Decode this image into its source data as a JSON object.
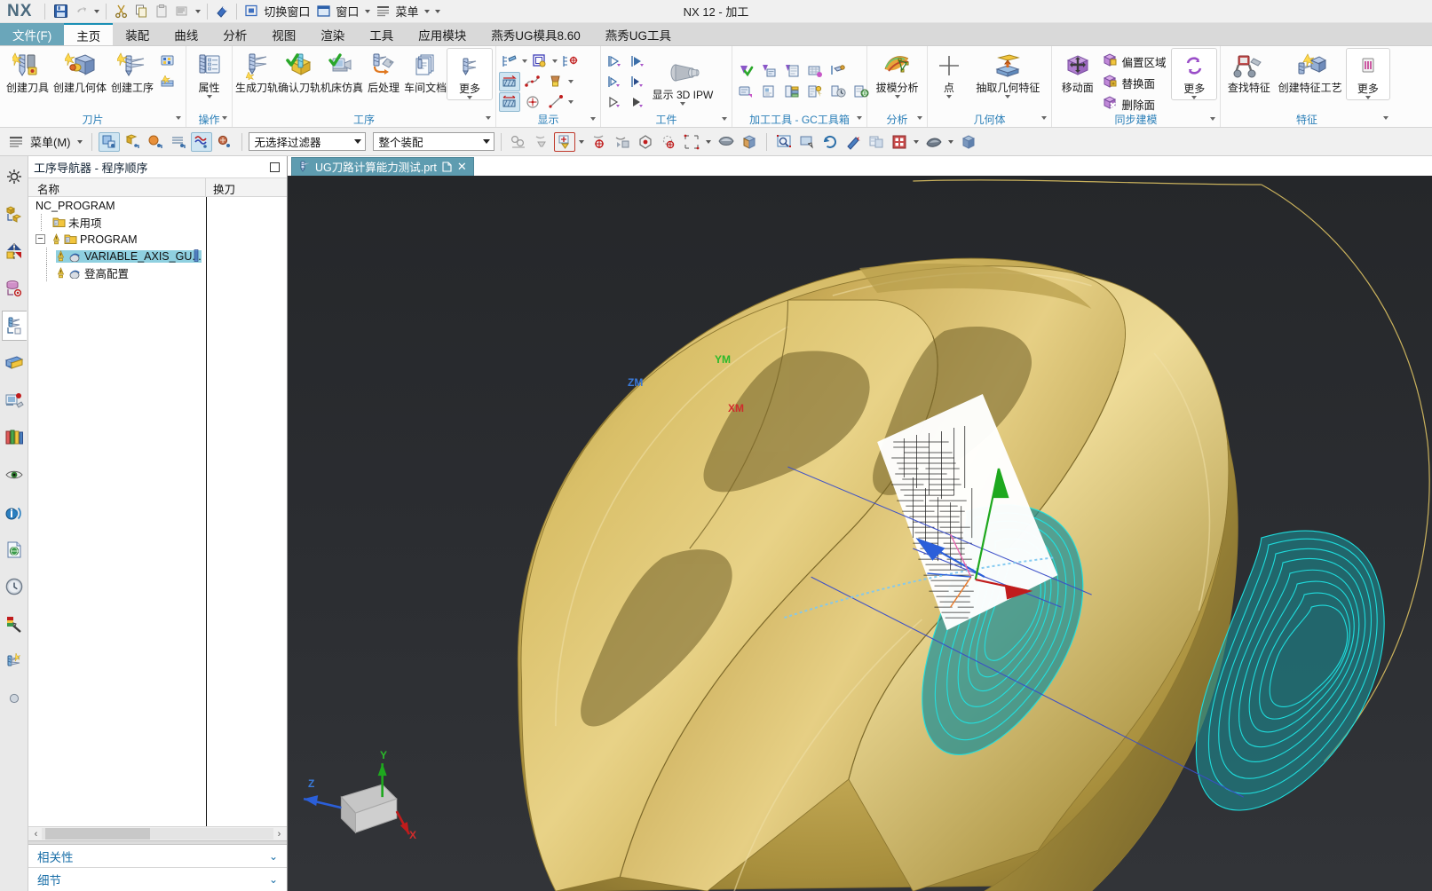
{
  "window": {
    "title": "NX 12 - 加工",
    "logo": "NX"
  },
  "quickaccess": {
    "items": [
      {
        "name": "save",
        "icon": "save-icon"
      },
      {
        "name": "undo",
        "icon": "undo-icon",
        "caret": true
      },
      {
        "name": "cut",
        "icon": "cut-icon"
      },
      {
        "name": "copy",
        "icon": "copy-icon"
      },
      {
        "name": "paste",
        "icon": "paste-icon"
      },
      {
        "name": "paste-special",
        "icon": "paste-special-icon",
        "caret": true
      },
      {
        "name": "eraser",
        "icon": "eraser-icon"
      }
    ],
    "switch_window": "切换窗口",
    "window": "窗口",
    "menu": "菜单"
  },
  "tabs": [
    {
      "label": "文件(F)",
      "kind": "file"
    },
    {
      "label": "主页",
      "kind": "active"
    },
    {
      "label": "装配",
      "kind": "normal"
    },
    {
      "label": "曲线",
      "kind": "normal"
    },
    {
      "label": "分析",
      "kind": "normal"
    },
    {
      "label": "视图",
      "kind": "normal"
    },
    {
      "label": "渲染",
      "kind": "normal"
    },
    {
      "label": "工具",
      "kind": "normal"
    },
    {
      "label": "应用模块",
      "kind": "normal"
    },
    {
      "label": "燕秀UG模具8.60",
      "kind": "normal"
    },
    {
      "label": "燕秀UG工具",
      "kind": "normal"
    }
  ],
  "ribbon": {
    "groups": [
      {
        "title": "刀片",
        "big": [
          {
            "label": "创建刀具",
            "icon": "create-tool-icon"
          },
          {
            "label": "创建几何体",
            "icon": "create-geometry-icon"
          },
          {
            "label": "创建工序",
            "icon": "create-operation-icon"
          }
        ],
        "small": [
          {
            "icon": "program-group-icon"
          },
          {
            "icon": "method-group-icon"
          }
        ]
      },
      {
        "title": "操作",
        "big": [
          {
            "label": "属性",
            "icon": "properties-icon",
            "dd": true
          }
        ],
        "small": []
      },
      {
        "title": "工序",
        "big": [
          {
            "label": "生成刀轨",
            "icon": "generate-toolpath-icon"
          },
          {
            "label": "确认刀轨",
            "icon": "verify-toolpath-icon"
          },
          {
            "label": "机床仿真",
            "icon": "machine-simulation-icon"
          },
          {
            "label": "后处理",
            "icon": "postprocess-icon"
          },
          {
            "label": "车间文档",
            "icon": "shop-documentation-icon"
          },
          {
            "label": "更多",
            "icon": "more-operation-icon",
            "framed": true,
            "dd": true
          }
        ],
        "small": []
      },
      {
        "title": "显示",
        "big": [],
        "small": [
          {
            "icon": "display-toolpath-icon",
            "caret": true
          },
          {
            "icon": "display-ipw-icon",
            "caret": true
          },
          {
            "icon": "display-target-icon"
          },
          {
            "icon": "cut-region-icon",
            "selected": true
          },
          {
            "icon": "spline-icon"
          },
          {
            "icon": "tool-display-icon",
            "caret": true
          },
          {
            "icon": "trim-region-icon",
            "selected": true
          },
          {
            "icon": "circle-center-icon"
          },
          {
            "icon": "line-point-icon",
            "caret": true
          }
        ]
      },
      {
        "title": "工件",
        "big": [
          {
            "label": "显示 3D IPW",
            "icon": "ipw-3d-icon",
            "dd": true
          }
        ],
        "small": [
          {
            "icon": "play-start-icon"
          },
          {
            "icon": "play-fill-icon"
          },
          {
            "icon": "play-step-icon"
          },
          {
            "icon": "play-fast-icon"
          },
          {
            "icon": "play-outline-icon"
          },
          {
            "icon": "play-last-icon"
          }
        ]
      },
      {
        "title": "加工工具 - GC工具箱",
        "big": [],
        "small": [
          {
            "icon": "check-tool-icon"
          },
          {
            "icon": "tool-list-icon"
          },
          {
            "icon": "tool-sheet-icon"
          },
          {
            "icon": "grid-tool-icon"
          },
          {
            "icon": "probe-icon"
          },
          {
            "icon": "note-tool-icon"
          },
          {
            "icon": "report-icon"
          },
          {
            "icon": "table-tool-icon"
          },
          {
            "icon": "params-icon"
          },
          {
            "icon": "time-tool-icon"
          },
          {
            "icon": "export-tool-icon"
          }
        ]
      },
      {
        "title": "分析",
        "big": [
          {
            "label": "拔模分析",
            "icon": "draft-analysis-icon",
            "dd": true
          }
        ],
        "small": []
      },
      {
        "title": "几何体",
        "big": [
          {
            "label": "点",
            "icon": "point-icon",
            "dd": true
          },
          {
            "label": "抽取几何特征",
            "icon": "extract-geometry-icon",
            "dd": true
          }
        ],
        "small": []
      },
      {
        "title": "同步建模",
        "big": [
          {
            "label": "移动面",
            "icon": "move-face-icon"
          },
          {
            "label": "更多",
            "icon": "sync-more-icon",
            "framed": true,
            "dd": true
          }
        ],
        "labeled": [
          {
            "label": "偏置区域",
            "icon": "offset-region-icon"
          },
          {
            "label": "替换面",
            "icon": "replace-face-icon"
          },
          {
            "label": "删除面",
            "icon": "delete-face-icon"
          }
        ]
      },
      {
        "title": "特征",
        "big": [
          {
            "label": "查找特征",
            "icon": "find-feature-icon"
          },
          {
            "label": "创建特征工艺",
            "icon": "create-feature-process-icon"
          },
          {
            "label": "更多",
            "icon": "feature-more-icon",
            "framed": true,
            "dd": true
          }
        ],
        "small": []
      }
    ]
  },
  "seltoolbar": {
    "menu_label": "菜单(M)",
    "filter_value": "无选择过滤器",
    "scope_value": "整个装配",
    "left_icons": [
      {
        "icon": "select-general-icon",
        "selected": true
      },
      {
        "icon": "select-feature-icon"
      },
      {
        "icon": "select-body-icon"
      },
      {
        "icon": "select-face-icon"
      },
      {
        "icon": "select-curve-icon",
        "selected": true
      },
      {
        "icon": "select-component-icon"
      }
    ],
    "right_icons": [
      {
        "icon": "snap-point-group-icon"
      },
      {
        "icon": "snap-filter-icon"
      },
      {
        "icon": "snap-enable-icon",
        "selected": true,
        "caret": true
      },
      {
        "icon": "snap-arc-center-icon"
      },
      {
        "icon": "snap-quadrant-icon"
      },
      {
        "icon": "snap-existing-point-icon"
      },
      {
        "icon": "snap-intersection-icon"
      },
      {
        "icon": "rectangle-select-icon",
        "caret": true
      },
      {
        "icon": "shaded-body-icon"
      },
      {
        "icon": "colored-body-icon"
      },
      {
        "icon": "zoom-window-icon"
      },
      {
        "icon": "pan-icon"
      },
      {
        "icon": "rotate-icon"
      },
      {
        "icon": "fit-icon"
      },
      {
        "icon": "view-sections-icon"
      },
      {
        "icon": "view-style-icon",
        "caret": true
      },
      {
        "icon": "shading-mode-icon",
        "caret": true
      },
      {
        "icon": "perspective-icon"
      }
    ]
  },
  "resourcebar": {
    "items": [
      {
        "icon": "assembly-nav-icon",
        "name": "assembly-navigator"
      },
      {
        "icon": "part-nav-icon",
        "name": "part-navigator"
      },
      {
        "icon": "constraint-nav-icon",
        "name": "constraint-navigator"
      },
      {
        "icon": "cylinder-nav-icon",
        "name": "reuse-library"
      },
      {
        "icon": "operation-nav-icon",
        "name": "operation-navigator",
        "active": true
      },
      {
        "icon": "roles-icon",
        "name": "roles"
      },
      {
        "icon": "system-scene-icon",
        "name": "system-scene"
      },
      {
        "icon": "library-icon",
        "name": "part-library"
      },
      {
        "icon": "view-eye-icon",
        "name": "view-manager"
      },
      {
        "icon": "info-wifi-icon",
        "name": "internet-explorer"
      },
      {
        "icon": "history-doc-icon",
        "name": "history-page"
      },
      {
        "icon": "clock-icon",
        "name": "process-studio"
      },
      {
        "icon": "color-wand-icon",
        "name": "hd3d-tools"
      },
      {
        "icon": "machining-wizard-icon",
        "name": "machining-feature-navigator"
      },
      {
        "icon": "more-resource-icon",
        "name": "more-resources"
      }
    ]
  },
  "navigator": {
    "title": "工序导航器 - 程序顺序",
    "columns": [
      "名称",
      "换刀"
    ],
    "rows": [
      {
        "label": "NC_PROGRAM",
        "depth": 0,
        "icon": "none",
        "expander": "none",
        "selected": false,
        "warn": false
      },
      {
        "label": "未用项",
        "depth": 1,
        "icon": "folder-icon",
        "expander": "none",
        "selected": false,
        "warn": false
      },
      {
        "label": "PROGRAM",
        "depth": 1,
        "icon": "folder-icon",
        "expander": "minus",
        "selected": false,
        "warn": true
      },
      {
        "label": "VARIABLE_AXIS_GU...",
        "depth": 2,
        "icon": "operation-icon",
        "expander": "none",
        "selected": true,
        "warn": true,
        "tool_change": "toolchange-icon"
      },
      {
        "label": "登高配置",
        "depth": 2,
        "icon": "operation-icon",
        "expander": "none",
        "selected": false,
        "warn": true
      }
    ],
    "panels": [
      {
        "label": "相关性",
        "expanded": false
      },
      {
        "label": "细节",
        "expanded": false
      }
    ]
  },
  "document": {
    "tab_label": "UG刀路计算能力测试.prt",
    "tab_icon": "part-icon",
    "modified_icon": "modified-icon",
    "close_icon": "close-icon"
  },
  "viewport": {
    "wcs_labels": [
      {
        "text": "ZM",
        "color": "#2b5fd9"
      },
      {
        "text": "YM",
        "color": "#1ea81e"
      },
      {
        "text": "XM",
        "color": "#c01c1c"
      }
    ],
    "triad_labels": [
      {
        "text": "Z",
        "color": "#2b5fd9"
      },
      {
        "text": "Y",
        "color": "#1ea81e"
      },
      {
        "text": "X",
        "color": "#c01c1c"
      }
    ],
    "colors": {
      "background_top": "#25272a",
      "background_bottom": "#303236",
      "model": "#d8bb63",
      "toolpath": "#1fe0e0",
      "wcs_z": "#2b5fd9",
      "wcs_y": "#1ea81e",
      "wcs_x": "#c01c1c",
      "boundary": "#c8b15a"
    }
  }
}
